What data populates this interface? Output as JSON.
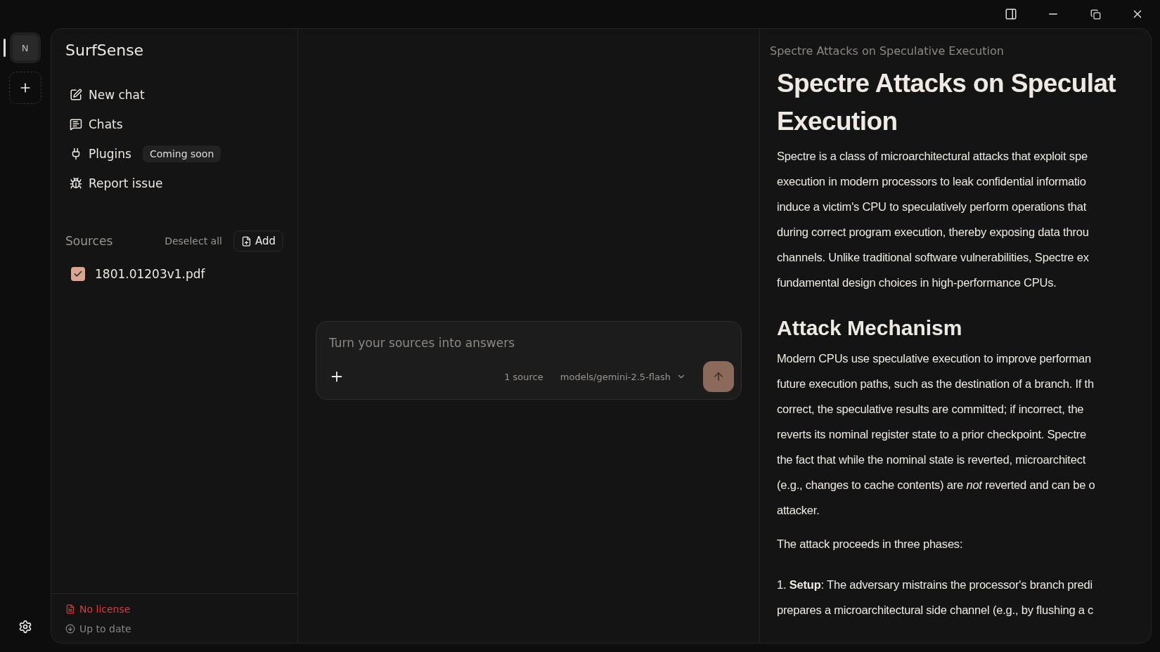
{
  "rail": {
    "workspace_initial": "N",
    "workspace_selected": true
  },
  "sidebar": {
    "app_name": "SurfSense",
    "nav": [
      {
        "kind": "new-chat",
        "label": "New chat"
      },
      {
        "kind": "chats",
        "label": "Chats"
      },
      {
        "kind": "plugins",
        "label": "Plugins",
        "badge": "Coming soon"
      },
      {
        "kind": "report",
        "label": "Report issue"
      }
    ],
    "sources": {
      "title": "Sources",
      "deselect": "Deselect all",
      "add": "Add",
      "items": [
        {
          "name": "1801.01203v1.pdf",
          "checked": true
        }
      ]
    },
    "footer": [
      {
        "kind": "license",
        "label": "No license"
      },
      {
        "kind": "update",
        "label": "Up to date"
      }
    ]
  },
  "composer": {
    "placeholder": "Turn your sources into answers",
    "source_count": "1 source",
    "model": "models/gemini-2.5-flash"
  },
  "document": {
    "breadcrumb": "Spectre Attacks on Speculative Execution",
    "blocks": [
      {
        "kind": "h1",
        "lines": [
          "Spectre Attacks on Speculat",
          "Execution"
        ]
      },
      {
        "kind": "p",
        "lines": [
          "Spectre is a class of microarchitectural attacks that exploit spe",
          "execution in modern processors to leak confidential informatio",
          "induce a victim's CPU to speculatively perform operations that",
          "during correct program execution, thereby exposing data throu",
          "channels. Unlike traditional software vulnerabilities, Spectre ex",
          "fundamental design choices in high-performance CPUs."
        ]
      },
      {
        "kind": "h2",
        "lines": [
          "Attack Mechanism"
        ]
      },
      {
        "kind": "p",
        "lines": [
          "Modern CPUs use speculative execution to improve performan",
          "future execution paths, such as the destination of a branch. If th",
          "correct, the speculative results are committed; if incorrect, the",
          "reverts its nominal register state to a prior checkpoint. Spectre",
          "the fact that while the nominal state is reverted, microarchitect",
          "(e.g., changes to cache contents) are *not* reverted and can be o",
          "attacker."
        ]
      },
      {
        "kind": "p",
        "lines": [
          "The attack proceeds in three phases:"
        ]
      },
      {
        "kind": "p",
        "lines": [
          "1. **Setup**: The adversary mistrains the processor's branch predi",
          "prepares a microarchitectural side channel (e.g., by flushing a c"
        ]
      }
    ]
  }
}
